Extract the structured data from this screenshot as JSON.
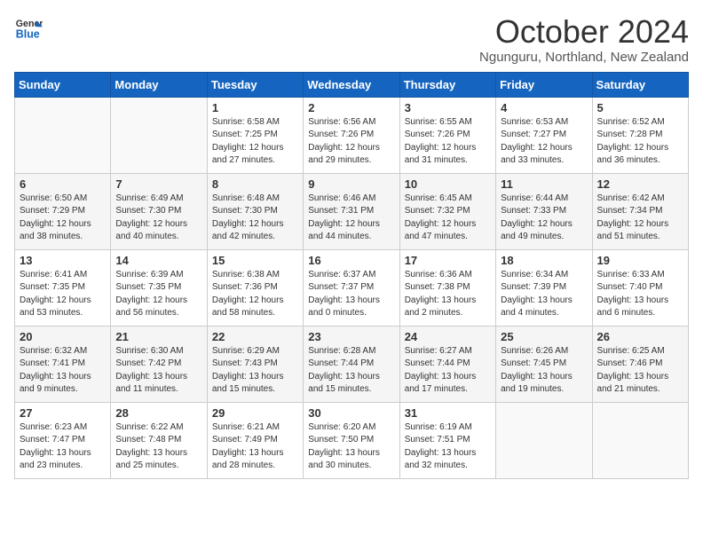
{
  "header": {
    "logo": {
      "line1": "General",
      "line2": "Blue"
    },
    "title": "October 2024",
    "location": "Ngunguru, Northland, New Zealand"
  },
  "days_of_week": [
    "Sunday",
    "Monday",
    "Tuesday",
    "Wednesday",
    "Thursday",
    "Friday",
    "Saturday"
  ],
  "weeks": [
    [
      {
        "day": "",
        "info": ""
      },
      {
        "day": "",
        "info": ""
      },
      {
        "day": "1",
        "info": "Sunrise: 6:58 AM\nSunset: 7:25 PM\nDaylight: 12 hours\nand 27 minutes."
      },
      {
        "day": "2",
        "info": "Sunrise: 6:56 AM\nSunset: 7:26 PM\nDaylight: 12 hours\nand 29 minutes."
      },
      {
        "day": "3",
        "info": "Sunrise: 6:55 AM\nSunset: 7:26 PM\nDaylight: 12 hours\nand 31 minutes."
      },
      {
        "day": "4",
        "info": "Sunrise: 6:53 AM\nSunset: 7:27 PM\nDaylight: 12 hours\nand 33 minutes."
      },
      {
        "day": "5",
        "info": "Sunrise: 6:52 AM\nSunset: 7:28 PM\nDaylight: 12 hours\nand 36 minutes."
      }
    ],
    [
      {
        "day": "6",
        "info": "Sunrise: 6:50 AM\nSunset: 7:29 PM\nDaylight: 12 hours\nand 38 minutes."
      },
      {
        "day": "7",
        "info": "Sunrise: 6:49 AM\nSunset: 7:30 PM\nDaylight: 12 hours\nand 40 minutes."
      },
      {
        "day": "8",
        "info": "Sunrise: 6:48 AM\nSunset: 7:30 PM\nDaylight: 12 hours\nand 42 minutes."
      },
      {
        "day": "9",
        "info": "Sunrise: 6:46 AM\nSunset: 7:31 PM\nDaylight: 12 hours\nand 44 minutes."
      },
      {
        "day": "10",
        "info": "Sunrise: 6:45 AM\nSunset: 7:32 PM\nDaylight: 12 hours\nand 47 minutes."
      },
      {
        "day": "11",
        "info": "Sunrise: 6:44 AM\nSunset: 7:33 PM\nDaylight: 12 hours\nand 49 minutes."
      },
      {
        "day": "12",
        "info": "Sunrise: 6:42 AM\nSunset: 7:34 PM\nDaylight: 12 hours\nand 51 minutes."
      }
    ],
    [
      {
        "day": "13",
        "info": "Sunrise: 6:41 AM\nSunset: 7:35 PM\nDaylight: 12 hours\nand 53 minutes."
      },
      {
        "day": "14",
        "info": "Sunrise: 6:39 AM\nSunset: 7:35 PM\nDaylight: 12 hours\nand 56 minutes."
      },
      {
        "day": "15",
        "info": "Sunrise: 6:38 AM\nSunset: 7:36 PM\nDaylight: 12 hours\nand 58 minutes."
      },
      {
        "day": "16",
        "info": "Sunrise: 6:37 AM\nSunset: 7:37 PM\nDaylight: 13 hours\nand 0 minutes."
      },
      {
        "day": "17",
        "info": "Sunrise: 6:36 AM\nSunset: 7:38 PM\nDaylight: 13 hours\nand 2 minutes."
      },
      {
        "day": "18",
        "info": "Sunrise: 6:34 AM\nSunset: 7:39 PM\nDaylight: 13 hours\nand 4 minutes."
      },
      {
        "day": "19",
        "info": "Sunrise: 6:33 AM\nSunset: 7:40 PM\nDaylight: 13 hours\nand 6 minutes."
      }
    ],
    [
      {
        "day": "20",
        "info": "Sunrise: 6:32 AM\nSunset: 7:41 PM\nDaylight: 13 hours\nand 9 minutes."
      },
      {
        "day": "21",
        "info": "Sunrise: 6:30 AM\nSunset: 7:42 PM\nDaylight: 13 hours\nand 11 minutes."
      },
      {
        "day": "22",
        "info": "Sunrise: 6:29 AM\nSunset: 7:43 PM\nDaylight: 13 hours\nand 15 minutes."
      },
      {
        "day": "23",
        "info": "Sunrise: 6:28 AM\nSunset: 7:44 PM\nDaylight: 13 hours\nand 15 minutes."
      },
      {
        "day": "24",
        "info": "Sunrise: 6:27 AM\nSunset: 7:44 PM\nDaylight: 13 hours\nand 17 minutes."
      },
      {
        "day": "25",
        "info": "Sunrise: 6:26 AM\nSunset: 7:45 PM\nDaylight: 13 hours\nand 19 minutes."
      },
      {
        "day": "26",
        "info": "Sunrise: 6:25 AM\nSunset: 7:46 PM\nDaylight: 13 hours\nand 21 minutes."
      }
    ],
    [
      {
        "day": "27",
        "info": "Sunrise: 6:23 AM\nSunset: 7:47 PM\nDaylight: 13 hours\nand 23 minutes."
      },
      {
        "day": "28",
        "info": "Sunrise: 6:22 AM\nSunset: 7:48 PM\nDaylight: 13 hours\nand 25 minutes."
      },
      {
        "day": "29",
        "info": "Sunrise: 6:21 AM\nSunset: 7:49 PM\nDaylight: 13 hours\nand 28 minutes."
      },
      {
        "day": "30",
        "info": "Sunrise: 6:20 AM\nSunset: 7:50 PM\nDaylight: 13 hours\nand 30 minutes."
      },
      {
        "day": "31",
        "info": "Sunrise: 6:19 AM\nSunset: 7:51 PM\nDaylight: 13 hours\nand 32 minutes."
      },
      {
        "day": "",
        "info": ""
      },
      {
        "day": "",
        "info": ""
      }
    ]
  ]
}
